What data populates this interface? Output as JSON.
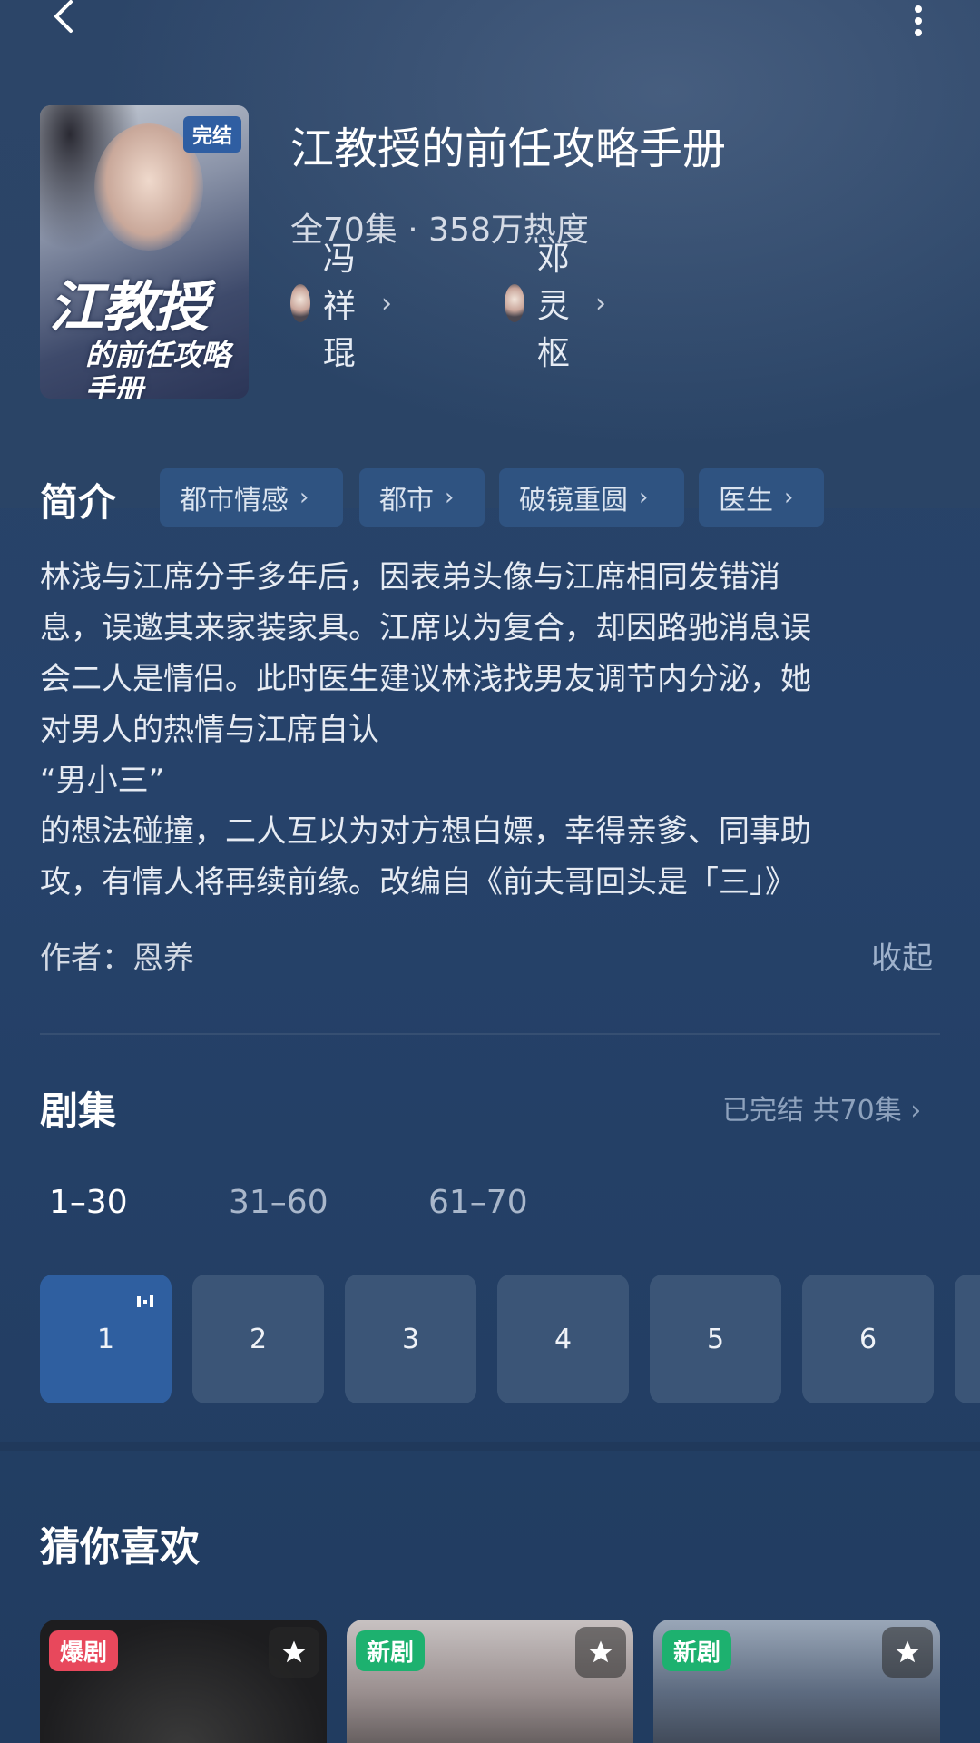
{
  "nav": {
    "back_icon": "chevron-left-icon",
    "more_icon": "vertical-dots-icon"
  },
  "poster": {
    "badge": "完结",
    "title_main": "江教授",
    "title_sub": "的前任攻略手册"
  },
  "show": {
    "title": "江教授的前任攻略手册",
    "meta": "全70集 · 358万热度",
    "cast": [
      {
        "name": "冯祥琨",
        "chevron": "›"
      },
      {
        "name": "邓灵枢",
        "chevron": "›"
      }
    ]
  },
  "intro": {
    "heading": "简介",
    "tags": [
      "都市情感",
      "都市",
      "破镜重圆",
      "医生"
    ],
    "tag_chevron": "›",
    "synopsis_lines": [
      "林浅与江席分手多年后，因表弟头像与江席相同发错消",
      "息，误邀其来家装家具。江席以为复合，却因路驰消息误",
      "会二人是情侣。此时医生建议林浅找男友调节内分泌，她",
      "对男人的热情与江席自认",
      "“男小三”",
      "的想法碰撞，二人互以为对方想白嫖，幸得亲爹、同事助",
      "攻，有情人将再续前缘。改编自《前夫哥回头是「三」》"
    ],
    "author": "作者：恩养",
    "collapse_label": "收起"
  },
  "episodes": {
    "heading": "剧集",
    "status": "已完结 共70集 ›",
    "ranges": [
      "1–30",
      "31–60",
      "61–70"
    ],
    "active_range": 0,
    "items": [
      "1",
      "2",
      "3",
      "4",
      "5",
      "6"
    ],
    "active_episode": 0
  },
  "recommend": {
    "heading": "猜你喜欢",
    "cards": [
      {
        "badge": "爆剧",
        "badge_color": "#e8485c"
      },
      {
        "badge": "新剧",
        "badge_color": "#1db16f"
      },
      {
        "badge": "新剧",
        "badge_color": "#1db16f"
      }
    ]
  },
  "colors": {
    "accent": "#2f5fa0",
    "tag_bg": "#2f5381",
    "background": "#26426a"
  }
}
